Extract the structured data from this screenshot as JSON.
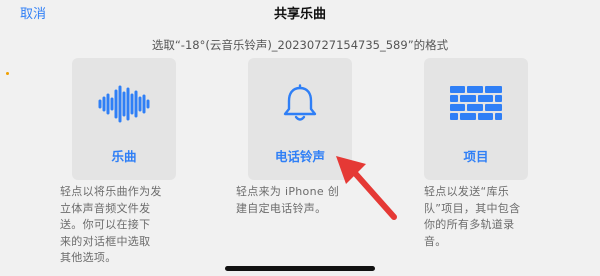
{
  "header": {
    "cancel_label": "取消",
    "title": "共享乐曲",
    "subtitle": "选取“-18°(云音乐铃声)_20230727154735_589”的格式"
  },
  "options": [
    {
      "label": "乐曲",
      "icon": "waveform-icon",
      "description": [
        "轻点以将乐曲作为发",
        "立体声音频文件发",
        "送。你可以在接下",
        "来的对话框中选取",
        "其他选项。"
      ]
    },
    {
      "label": "电话铃声",
      "icon": "bell-icon",
      "description": [
        "轻点来为 iPhone 创",
        "建自定电话铃声。"
      ]
    },
    {
      "label": "项目",
      "icon": "brick-wall-icon",
      "description": [
        "轻点以发送“库乐",
        "队”项目，其中包含",
        "你的所有多轨道录",
        "音。"
      ]
    }
  ],
  "colors": {
    "accent": "#2f7ff6",
    "arrow": "#e53935",
    "background": "#f1f1f1",
    "card": "#e4e4e4"
  }
}
